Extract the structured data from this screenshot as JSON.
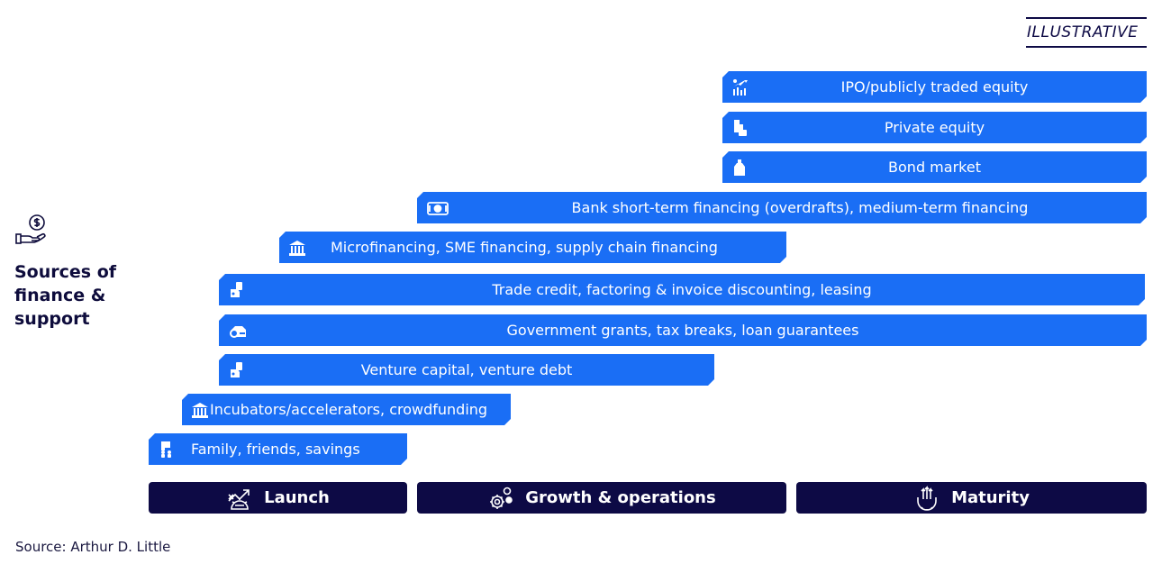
{
  "tag": "ILLUSTRATIVE",
  "side_panel": {
    "icon": "hand-holding-dollar-icon",
    "title_lines": [
      "Sources of",
      "finance &",
      "support"
    ]
  },
  "colors": {
    "bar": "#1a6ef5",
    "stage": "#0d0a45",
    "text_dark": "#0e0c3c"
  },
  "stages": [
    {
      "label": "Launch",
      "icon": "growth-chart-gear-icon"
    },
    {
      "label": "Growth & operations",
      "icon": "gears-icon"
    },
    {
      "label": "Maturity",
      "icon": "hand-gear-arrows-icon"
    }
  ],
  "sources": [
    {
      "label": "IPO/publicly traded equity",
      "icon": "stock-chart-icon",
      "spans": "Maturity"
    },
    {
      "label": "Private equity",
      "icon": "investor-building-icon",
      "spans": "Maturity"
    },
    {
      "label": "Bond market",
      "icon": "bond-document-icon",
      "spans": "Maturity"
    },
    {
      "label": "Bank short-term financing (overdrafts), medium-term financing",
      "icon": "banknote-icon",
      "spans": "Growth & operations to Maturity"
    },
    {
      "label": "Microfinancing, SME financing, supply chain financing",
      "icon": "bank-building-icon",
      "spans": "Launch to Growth & operations"
    },
    {
      "label": "Trade credit, factoring & invoice discounting, leasing",
      "icon": "hand-money-icon",
      "spans": "Launch to Maturity"
    },
    {
      "label": "Government grants, tax breaks, loan guarantees",
      "icon": "government-grant-icon",
      "spans": "Launch to Maturity"
    },
    {
      "label": "Venture capital, venture debt",
      "icon": "hand-money-icon",
      "spans": "Launch to Growth & operations"
    },
    {
      "label": "Incubators/accelerators, crowdfunding",
      "icon": "bank-building-icon",
      "spans": "Launch to early Growth & operations"
    },
    {
      "label": "Family, friends, savings",
      "icon": "family-icon",
      "spans": "Launch"
    }
  ],
  "source_note": "Source: Arthur D. Little"
}
